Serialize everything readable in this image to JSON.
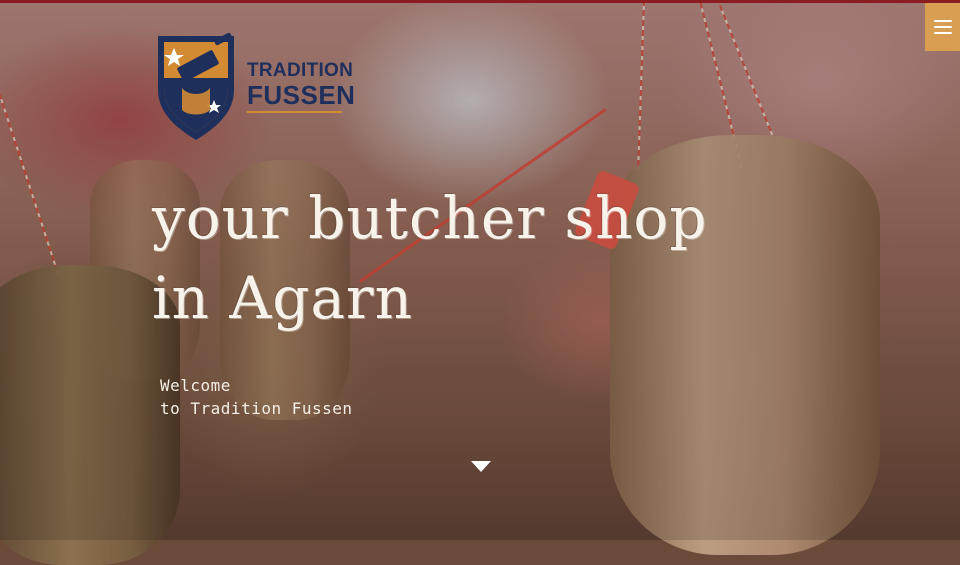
{
  "brand": {
    "line1": "TRADITION",
    "line2": "FUSSEN",
    "logo_icon": "shield-cleaver-logo",
    "colors": {
      "navy": "#1f2f5c",
      "ochre": "#d28a33"
    }
  },
  "header": {
    "menu_icon": "hamburger-menu-icon",
    "menu_color": "#d99e52"
  },
  "hero": {
    "headline_line1": "your butcher shop",
    "headline_line2": "in Agarn",
    "welcome_line1": "Welcome",
    "welcome_line2": "to Tradition Fussen",
    "scroll_icon": "caret-down-icon"
  }
}
